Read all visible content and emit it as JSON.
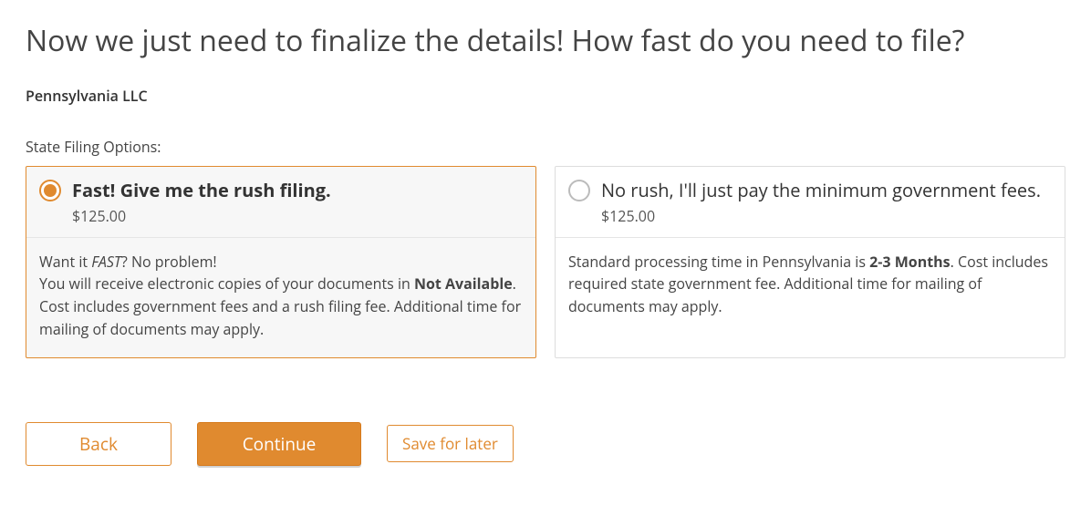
{
  "heading": "Now we just need to finalize the details! How fast do you need to file?",
  "entity": "Pennsylvania LLC",
  "section_label": "State Filing Options:",
  "options": [
    {
      "title": "Fast! Give me the rush filing.",
      "price": "$125.00",
      "body_lead": "Want it ",
      "body_emph": "FAST",
      "body_lead2": "? No problem!",
      "body_line2a": "You will receive electronic copies of your documents in ",
      "body_strong": "Not Available",
      "body_line2b": ". Cost includes government fees and a rush filing fee. Additional time for mailing of documents may apply.",
      "selected": true
    },
    {
      "title": "No rush, I'll just pay the minimum government fees.",
      "price": "$125.00",
      "body_line_a": "Standard processing time in Pennsylvania is ",
      "body_strong": "2-3 Months",
      "body_line_b": ". Cost includes required state government fee. Additional time for mailing of documents may apply.",
      "selected": false
    }
  ],
  "buttons": {
    "back": "Back",
    "continue": "Continue",
    "save": "Save for later"
  }
}
